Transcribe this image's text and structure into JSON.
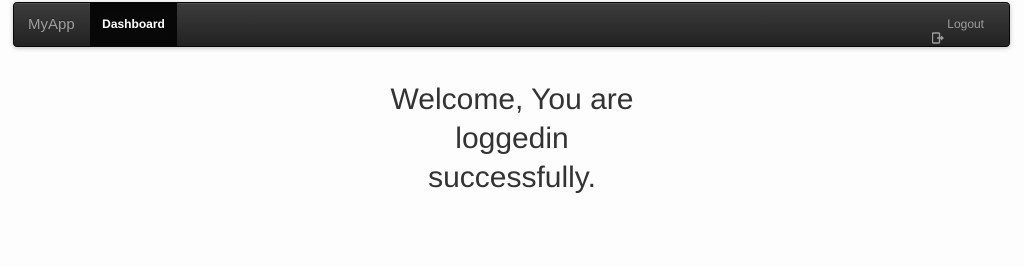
{
  "navbar": {
    "brand": "MyApp",
    "active_item": "Dashboard",
    "logout_label": "Logout",
    "logout_icon": "logout-icon"
  },
  "main": {
    "line1": "Welcome, You are",
    "line2": "loggedin",
    "line3": "successfully."
  },
  "colors": {
    "navbar_bg": "#222222",
    "active_bg": "#080808",
    "nav_text": "#9d9d9d",
    "body_text": "#333333"
  }
}
